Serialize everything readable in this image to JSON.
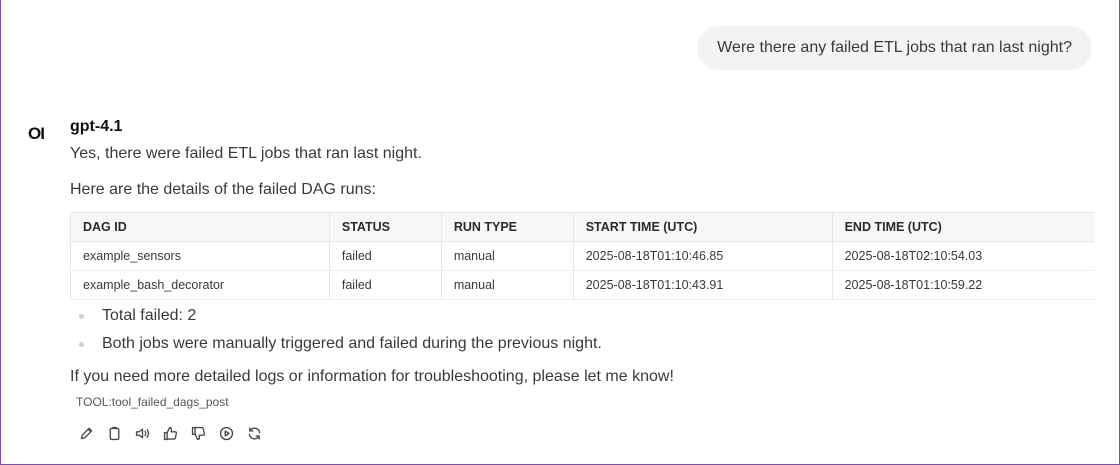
{
  "user_message": "Were there any failed ETL jobs that ran last night?",
  "assistant": {
    "avatar_text": "OI",
    "model_name": "gpt-4.1",
    "intro": "Yes, there were failed ETL jobs that ran last night.",
    "details_heading": "Here are the details of the failed DAG runs:",
    "table": {
      "headers": [
        "DAG ID",
        "STATUS",
        "RUN TYPE",
        "START TIME (UTC)",
        "END TIME (UTC)"
      ],
      "rows": [
        [
          "example_sensors",
          "failed",
          "manual",
          "2025-08-18T01:10:46.85",
          "2025-08-18T02:10:54.03"
        ],
        [
          "example_bash_decorator",
          "failed",
          "manual",
          "2025-08-18T01:10:43.91",
          "2025-08-18T01:10:59.22"
        ]
      ]
    },
    "bullets": [
      "Total failed: 2",
      "Both jobs were manually triggered and failed during the previous night."
    ],
    "closing": "If you need more detailed logs or information for troubleshooting, please let me know!",
    "tool_label": "TOOL:tool_failed_dags_post",
    "action_icons": [
      "pencil-icon",
      "clipboard-icon",
      "speaker-icon",
      "thumbs-up-icon",
      "thumbs-down-icon",
      "play-circle-icon",
      "refresh-icon"
    ]
  },
  "colors": {
    "frame_border": "#7b4fa8",
    "user_bubble_bg": "#f3f3f3",
    "table_header_bg": "#f7f7f7"
  }
}
